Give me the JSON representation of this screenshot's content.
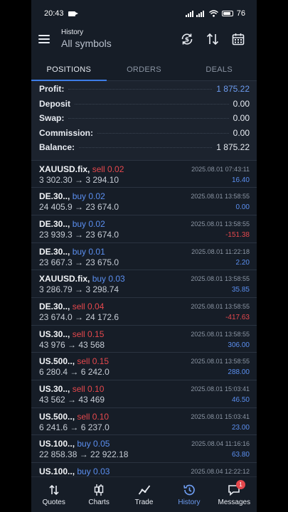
{
  "status": {
    "time": "20:43",
    "battery": "76"
  },
  "header": {
    "title": "History",
    "subtitle": "All symbols"
  },
  "tabs": [
    "POSITIONS",
    "ORDERS",
    "DEALS"
  ],
  "summary": [
    {
      "label": "Profit:",
      "value": "1 875.22",
      "accent": true
    },
    {
      "label": "Deposit",
      "value": "0.00",
      "accent": false
    },
    {
      "label": "Swap:",
      "value": "0.00",
      "accent": false
    },
    {
      "label": "Commission:",
      "value": "0.00",
      "accent": false
    },
    {
      "label": "Balance:",
      "value": "1 875.22",
      "accent": false
    }
  ],
  "deals": [
    {
      "symbol": "XAUUSD.fix,",
      "side": "sell",
      "volume": "sell 0.02",
      "prices": "3 302.30 → 3 294.10",
      "time": "2025.08.01 07:43:11",
      "profit": "16.40"
    },
    {
      "symbol": "DE.30..,",
      "side": "buy",
      "volume": "buy 0.02",
      "prices": "24 405.9 → 23 674.0",
      "time": "2025.08.01 13:58:55",
      "profit": "0.00"
    },
    {
      "symbol": "DE.30..,",
      "side": "buy",
      "volume": "buy 0.02",
      "prices": "23 939.3 → 23 674.0",
      "time": "2025.08.01 13:58:55",
      "profit": "-151.38"
    },
    {
      "symbol": "DE.30..,",
      "side": "buy",
      "volume": "buy 0.01",
      "prices": "23 667.3 → 23 675.0",
      "time": "2025.08.01 11:22:18",
      "profit": "2.20"
    },
    {
      "symbol": "XAUUSD.fix,",
      "side": "buy",
      "volume": "buy 0.03",
      "prices": "3 286.79 → 3 298.74",
      "time": "2025.08.01 13:58:55",
      "profit": "35.85"
    },
    {
      "symbol": "DE.30..,",
      "side": "sell",
      "volume": "sell 0.04",
      "prices": "23 674.0 → 24 172.6",
      "time": "2025.08.01 13:58:55",
      "profit": "-417.63"
    },
    {
      "symbol": "US.30..,",
      "side": "sell",
      "volume": "sell 0.15",
      "prices": "43 976 → 43 568",
      "time": "2025.08.01 13:58:55",
      "profit": "306.00"
    },
    {
      "symbol": "US.500..,",
      "side": "sell",
      "volume": "sell 0.15",
      "prices": "6 280.4 → 6 242.0",
      "time": "2025.08.01 13:58:55",
      "profit": "288.00"
    },
    {
      "symbol": "US.30..,",
      "side": "sell",
      "volume": "sell 0.10",
      "prices": "43 562 → 43 469",
      "time": "2025.08.01 15:03:41",
      "profit": "46.50"
    },
    {
      "symbol": "US.500..,",
      "side": "sell",
      "volume": "sell 0.10",
      "prices": "6 241.6 → 6 237.0",
      "time": "2025.08.01 15:03:41",
      "profit": "23.00"
    },
    {
      "symbol": "US.100..,",
      "side": "buy",
      "volume": "buy 0.05",
      "prices": "22 858.38 → 22 922.18",
      "time": "2025.08.04 11:16:16",
      "profit": "63.80"
    },
    {
      "symbol": "US.100..,",
      "side": "buy",
      "volume": "buy 0.03",
      "prices": "",
      "time": "2025.08.04 12:22:12",
      "profit": ""
    }
  ],
  "nav": [
    {
      "label": "Quotes",
      "icon": "quotes-icon"
    },
    {
      "label": "Charts",
      "icon": "charts-icon"
    },
    {
      "label": "Trade",
      "icon": "trade-icon"
    },
    {
      "label": "History",
      "icon": "history-icon",
      "active": true
    },
    {
      "label": "Messages",
      "icon": "messages-icon",
      "badge": "1"
    }
  ],
  "colors": {
    "background": "#161d27",
    "accent": "#3d7de8",
    "sell": "#e5484d",
    "buy": "#5b8ff0"
  }
}
